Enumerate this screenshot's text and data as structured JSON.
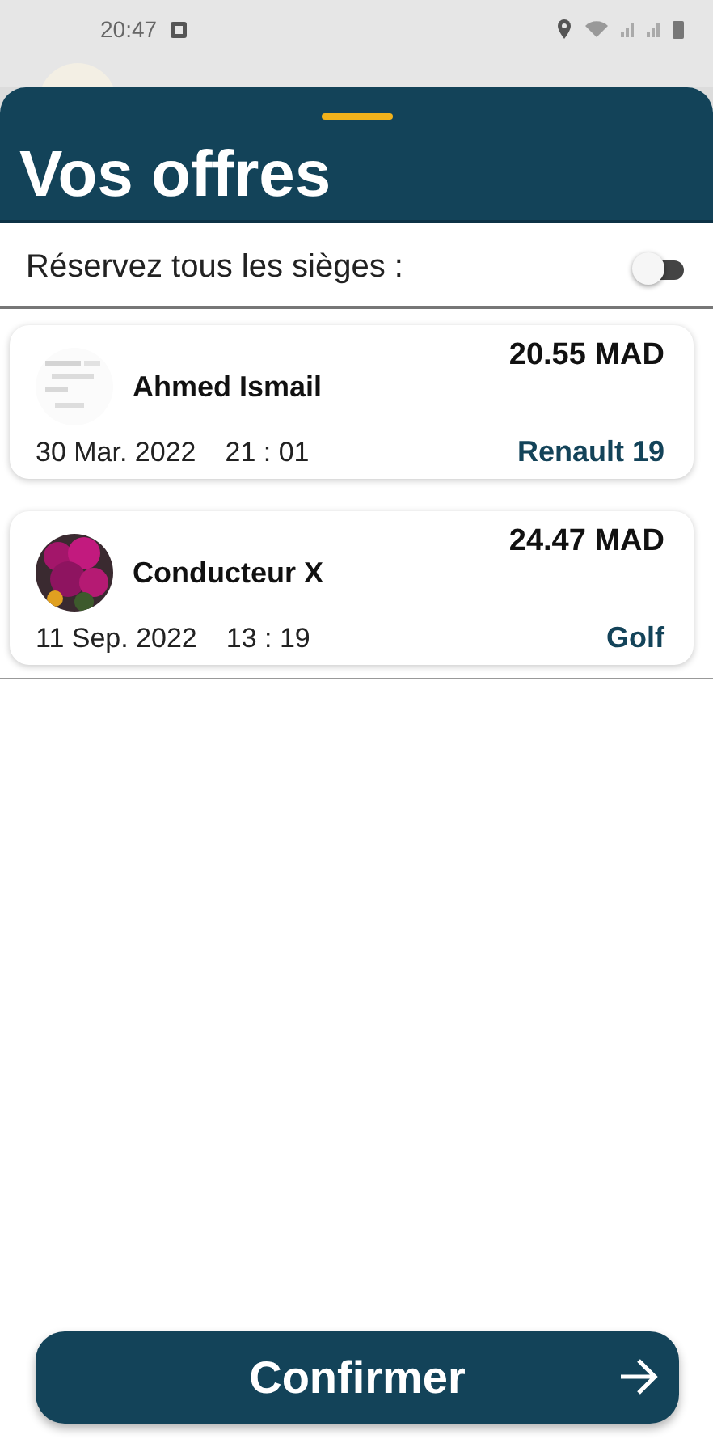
{
  "status_bar": {
    "time": "20:47"
  },
  "sheet": {
    "title": "Vos offres",
    "reserve_all": {
      "label": "Réservez tous les sièges :",
      "on": false
    },
    "offers": [
      {
        "driver": "Ahmed Ismail",
        "price": "20.55 MAD",
        "date": "30 Mar. 2022",
        "time": "21 : 01",
        "car": "Renault 19"
      },
      {
        "driver": "Conducteur X",
        "price": "24.47 MAD",
        "date": "11 Sep. 2022",
        "time": "13 : 19",
        "car": "Golf"
      }
    ]
  },
  "confirm_button": {
    "label": "Confirmer"
  }
}
